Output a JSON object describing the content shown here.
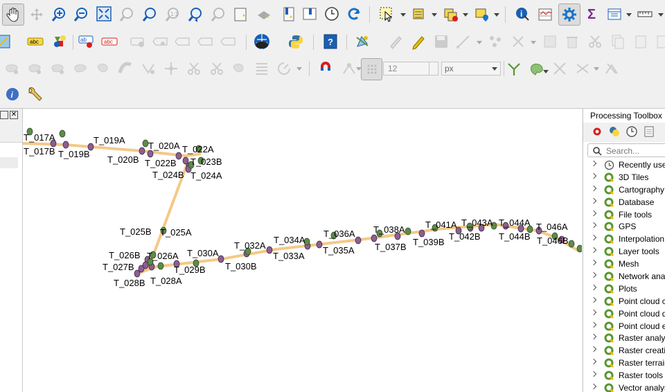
{
  "toolbar": {
    "row1": [
      "pan-icon",
      "pan-to-selection-icon",
      "zoom-in-icon",
      "zoom-out-icon",
      "zoom-full-icon",
      "zoom-to-selection-icon",
      "zoom-to-layer-icon",
      "zoom-native-icon",
      "zoom-last-icon",
      "zoom-next-icon",
      "new-bookmark-icon",
      "show-bookmarks-icon",
      "temporal-controller-icon",
      "refresh-icon",
      "select-features-icon",
      "select-by-value-icon",
      "deselect-icon",
      "select-by-location-icon",
      "identify-icon",
      "attribute-table-icon",
      "processing-toolbox-icon",
      "statistics-icon",
      "field-calculator-icon",
      "measure-icon"
    ],
    "row2": [
      "digitize-icon",
      "label-abc-icon",
      "label-style-icon",
      "label-pin-icon",
      "label-highlight-icon",
      "geolocate-icon",
      "python-icon",
      "help-icon",
      "vertex-tool-icon",
      "pencil-icon",
      "save-edits-icon"
    ],
    "row3": [
      "snapping-icon",
      "magnet-icon"
    ],
    "row4": [
      "info-icon",
      "wrench-icon"
    ],
    "snapping_tolerance": "12",
    "snapping_unit": "px"
  },
  "processing": {
    "title": "Processing Toolbox",
    "search_placeholder": "Search...",
    "items": [
      "Recently used",
      "3D Tiles",
      "Cartography",
      "Database",
      "File tools",
      "GPS",
      "Interpolation",
      "Layer tools",
      "Mesh",
      "Network analysis",
      "Plots",
      "Point cloud conversion",
      "Point cloud data management",
      "Point cloud extraction",
      "Raster analysis",
      "Raster creation",
      "Raster terrain analysis",
      "Raster tools",
      "Vector analysis"
    ]
  },
  "map": {
    "labels": [
      "T_017A",
      "T_017B",
      "T_019B",
      "T_019A",
      "T_020B",
      "T_020A",
      "T_022B",
      "T_022A",
      "T_023B",
      "T_024B",
      "T_024A",
      "T_025B",
      "T_025A",
      "T_026B",
      "T_026A",
      "T_027B",
      "T_028B",
      "T_028A",
      "T_029B",
      "T_030A",
      "T_030B",
      "T_032A",
      "T_033A",
      "T_034A",
      "T_035A",
      "T_036A",
      "T_037B",
      "T_038A",
      "T_039B",
      "T_041A",
      "T_042B",
      "T_043A",
      "T_044A",
      "T_044B",
      "T_046A",
      "T_046B"
    ]
  },
  "colors": {
    "accent": "#589632",
    "line": "#f4c987",
    "purple": "#8e5f92",
    "green": "#5e8b4a"
  }
}
